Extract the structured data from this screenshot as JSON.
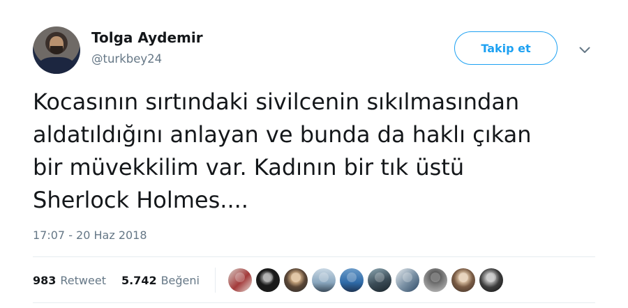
{
  "user": {
    "name": "Tolga Aydemir",
    "handle": "@turkbey24"
  },
  "follow_button": {
    "label": "Takip et"
  },
  "tweet": {
    "text": "Kocasının sırtındaki sivilcenin sıkılmasından\naldatıldığını anlayan ve bunda da haklı çıkan\nbir müvekkilim var. Kadının bir tık üstü\nSherlock Holmes....",
    "timestamp": "17:07 - 20 Haz 2018"
  },
  "stats": {
    "retweets": {
      "count": "983",
      "label": "Retweet"
    },
    "likes": {
      "count": "5.742",
      "label": "Beğeni"
    }
  },
  "colors": {
    "accent": "#1da1f2",
    "muted": "#657786",
    "text": "#14171a"
  }
}
